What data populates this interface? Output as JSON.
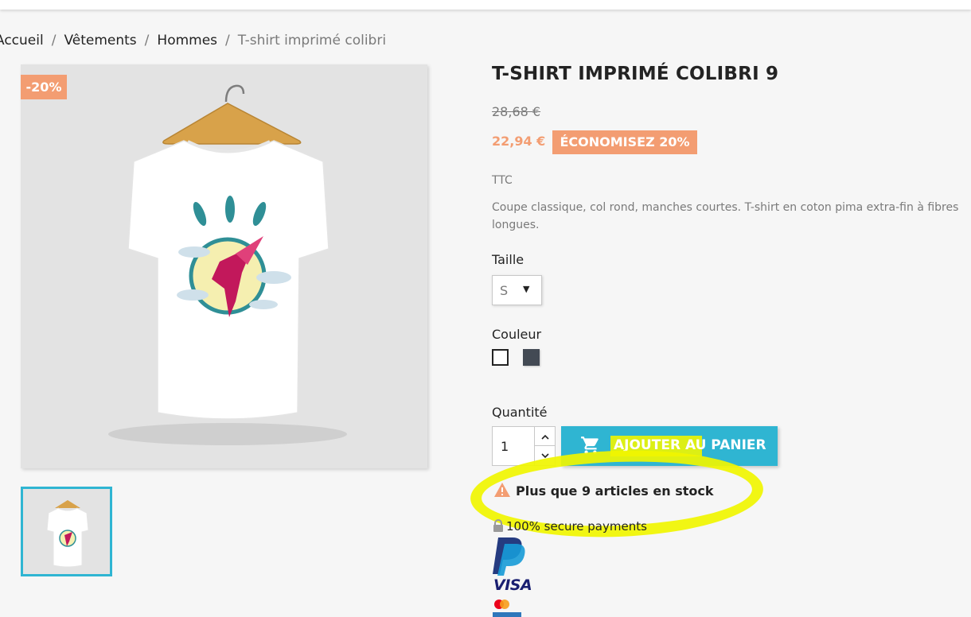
{
  "breadcrumb": {
    "home": "Accueil",
    "cat1": "Vêtements",
    "cat2": "Hommes",
    "current": "T-shirt imprimé colibri",
    "separator": "/"
  },
  "product": {
    "discount_flag": "-20%",
    "title": "T-SHIRT IMPRIMÉ COLIBRI 9",
    "old_price": "28,68 €",
    "price": "22,94 €",
    "save_label": "ÉCONOMISEZ 20%",
    "tax_label": "TTC",
    "description": "Coupe classique, col rond, manches courtes. T-shirt en coton pima extra-fin à fibres longues."
  },
  "variants": {
    "size_label": "Taille",
    "size_value": "S",
    "color_label": "Couleur",
    "colors": [
      "#ffffff",
      "#434a54"
    ]
  },
  "purchase": {
    "qty_label": "Quantité",
    "qty_value": "1",
    "add_to_cart": "AJOUTER AU PANIER",
    "stock_msg": "Plus que 9 articles en stock"
  },
  "payments": {
    "secure_label": "100% secure payments",
    "visa": "VISA"
  },
  "colors": {
    "accent": "#2fb5d2",
    "discount": "#f39d72",
    "highlight": "#f0f500"
  },
  "icons": [
    "cart-icon",
    "warning-icon",
    "lock-icon",
    "caret-down-icon",
    "chevron-up-icon",
    "chevron-down-icon",
    "paypal-logo",
    "mastercard-logo"
  ]
}
